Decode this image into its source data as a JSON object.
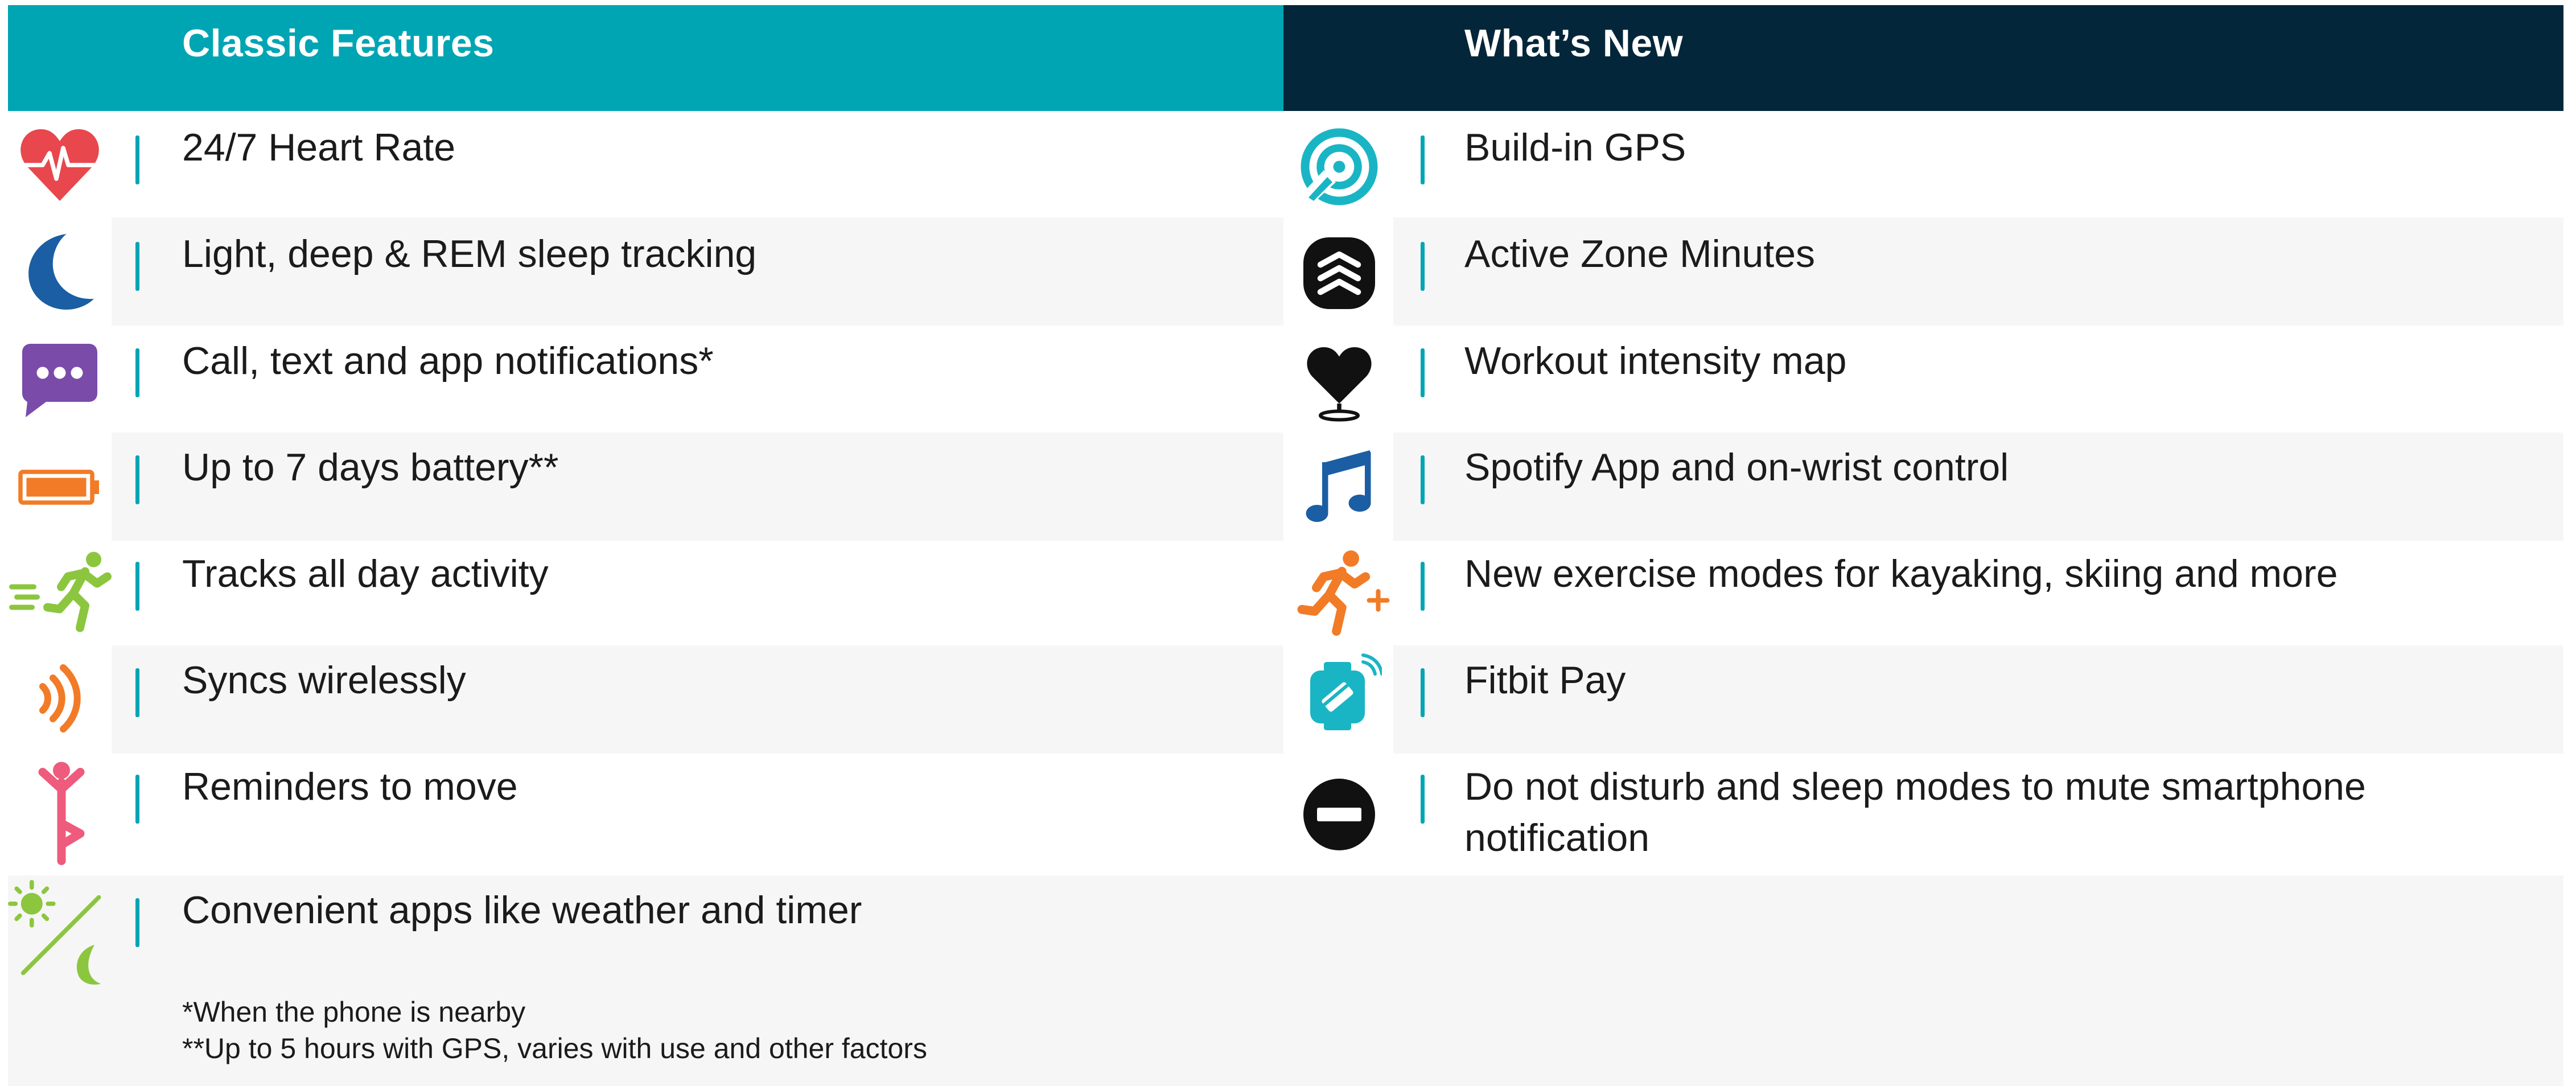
{
  "header": {
    "left_title": "Classic Features",
    "right_title": "What’s New"
  },
  "classic_features": [
    {
      "label": "24/7 Heart Rate",
      "icon": "heart-rate-icon"
    },
    {
      "label": "Light, deep & REM sleep tracking",
      "icon": "moon-icon"
    },
    {
      "label": "Call, text and app notifications*",
      "icon": "chat-bubble-icon"
    },
    {
      "label": "Up to 7 days battery**",
      "icon": "battery-icon"
    },
    {
      "label": "Tracks all day activity",
      "icon": "running-person-icon"
    },
    {
      "label": "Syncs wirelessly",
      "icon": "wireless-sync-icon"
    },
    {
      "label": "Reminders to move",
      "icon": "yoga-pose-icon"
    },
    {
      "label": "Convenient apps like weather and timer",
      "icon": "sun-moon-icon"
    }
  ],
  "whats_new": [
    {
      "label": "Build-in GPS",
      "icon": "gps-icon"
    },
    {
      "label": "Active Zone Minutes",
      "icon": "zone-minutes-icon"
    },
    {
      "label": "Workout intensity map",
      "icon": "heart-map-pin-icon"
    },
    {
      "label": "Spotify App and on-wrist control",
      "icon": "music-note-icon"
    },
    {
      "label": " New exercise modes for kayaking, skiing and more",
      "icon": "runner-plus-icon"
    },
    {
      "label": "Fitbit Pay",
      "icon": "fitbit-pay-icon"
    },
    {
      "label_line1": "Do not disturb and sleep modes to mute smartphone",
      "label_line2": "notification",
      "icon": "do-not-disturb-icon"
    }
  ],
  "footnotes": [
    "*When the phone is nearby",
    "**Up to 5 hours with GPS, varies with use and other factors"
  ],
  "colors": {
    "classic_header": "#00a5b4",
    "new_header": "#03263a",
    "divider": "#00a5b4",
    "band": "#f6f6f6"
  }
}
